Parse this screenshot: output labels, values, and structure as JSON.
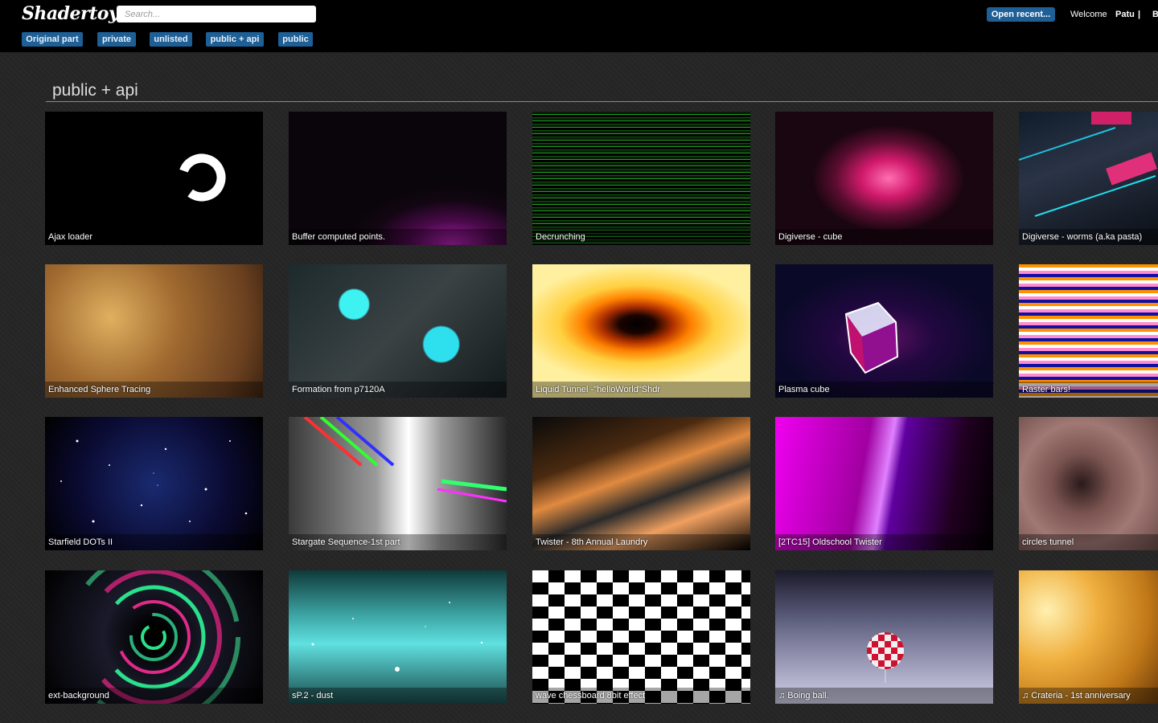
{
  "header": {
    "logo": "Shadertoy",
    "search_placeholder": "Search...",
    "open_recent": "Open recent...",
    "welcome": "Welcome",
    "username": "Patu",
    "separator": "|",
    "truncated": "B"
  },
  "tags": [
    "Original part",
    "private",
    "unlisted",
    "public + api",
    "public"
  ],
  "section": {
    "title": "public + api"
  },
  "shaders": [
    "Ajax loader",
    "Buffer computed points.",
    "Decrunching",
    "Digiverse - cube",
    "Digiverse - worms (a.ka pasta)",
    "Enhanced Sphere Tracing",
    "Formation from p7120A",
    "Liquid Tunnel -\"helloWorld\"Shdr",
    "Plasma cube",
    "Raster bars!",
    "Starfield DOTs II",
    "Stargate Sequence-1st part",
    "Twister - 8th Annual Laundry",
    "[2TC15] Oldschool Twister",
    "circles tunnel",
    "ext-background",
    "sP.2 - dust",
    "wave chessboard 8bit effect",
    "♫ Boing ball.",
    "♫ Crateria - 1st anniversary"
  ]
}
